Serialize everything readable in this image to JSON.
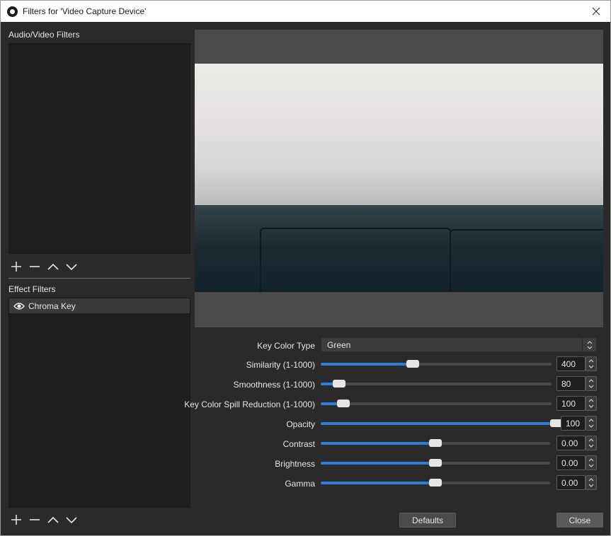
{
  "window": {
    "title": "Filters for 'Video Capture Device'"
  },
  "audio_video_filters": {
    "label": "Audio/Video Filters",
    "items": []
  },
  "effect_filters": {
    "label": "Effect Filters",
    "items": [
      {
        "label": "Chroma Key",
        "visible": true
      }
    ]
  },
  "properties": {
    "key_color_type": {
      "label": "Key Color Type",
      "value": "Green"
    },
    "similarity": {
      "label": "Similarity (1-1000)",
      "value": "400",
      "min": 1,
      "max": 1000,
      "level": 400
    },
    "smoothness": {
      "label": "Smoothness (1-1000)",
      "value": "80",
      "min": 1,
      "max": 1000,
      "level": 80
    },
    "spill": {
      "label": "Key Color Spill Reduction (1-1000)",
      "value": "100",
      "min": 1,
      "max": 1000,
      "level": 100
    },
    "opacity": {
      "label": "Opacity",
      "value": "100",
      "min": 0,
      "max": 100,
      "level": 100
    },
    "contrast": {
      "label": "Contrast",
      "value": "0.00",
      "min": -1,
      "max": 1,
      "level": 0
    },
    "brightness": {
      "label": "Brightness",
      "value": "0.00",
      "min": -1,
      "max": 1,
      "level": 0
    },
    "gamma": {
      "label": "Gamma",
      "value": "0.00",
      "min": -1,
      "max": 1,
      "level": 0
    }
  },
  "buttons": {
    "defaults": "Defaults",
    "close": "Close"
  },
  "colors": {
    "accent": "#2c7cd6",
    "background": "#2a2a2a",
    "panel": "#1e1e1e"
  },
  "icons": [
    "obs-logo-icon",
    "close-icon",
    "plus-icon",
    "minus-icon",
    "chevron-up-icon",
    "chevron-down-icon",
    "eye-icon",
    "spin-arrows-icon"
  ]
}
